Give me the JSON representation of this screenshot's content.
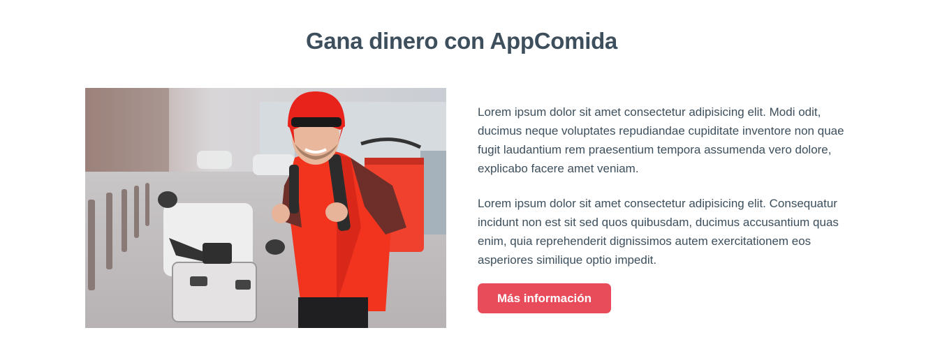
{
  "section": {
    "title": "Gana dinero con AppComida",
    "paragraphs": [
      "Lorem ipsum dolor sit amet consectetur adipisicing elit. Modi odit, ducimus neque voluptates repudiandae cupiditate inventore non quae fugit laudantium rem praesentium tempora assumenda vero dolore, explicabo facere amet veniam.",
      "Lorem ipsum dolor sit amet consectetur adipisicing elit. Consequatur incidunt non est sit sed quos quibusdam, ducimus accusantium quas enim, quia reprehenderit dignissimos autem exercitationem eos asperiores similique optio impedit."
    ],
    "button_label": "Más información",
    "image": "delivery-rider-photo"
  },
  "colors": {
    "heading": "#3d4f5c",
    "text": "#3d4f5c",
    "accent": "#e84c5b",
    "background": "#ffffff"
  }
}
